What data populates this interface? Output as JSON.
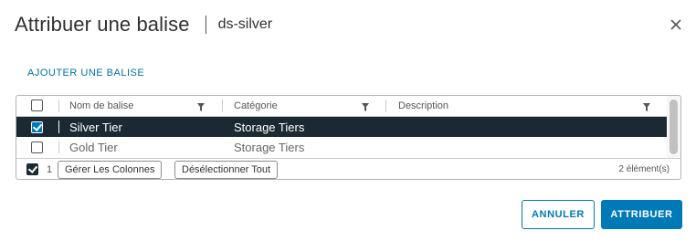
{
  "dialog": {
    "title": "Attribuer une balise",
    "subtitle": "ds-silver",
    "add_tag_label": "AJOUTER UNE BALISE"
  },
  "grid": {
    "columns": [
      {
        "label": "Nom de balise"
      },
      {
        "label": "Catégorie"
      },
      {
        "label": "Description"
      }
    ],
    "rows": [
      {
        "name": "Silver Tier",
        "category": "Storage Tiers",
        "description": "",
        "selected": true
      },
      {
        "name": "Gold Tier",
        "category": "Storage Tiers",
        "description": "",
        "selected": false
      }
    ],
    "footer": {
      "selected_count": "1",
      "manage_columns_label": "Gérer Les Colonnes",
      "deselect_all_label": "Désélectionner Tout",
      "item_count": "2 élément(s)"
    }
  },
  "actions": {
    "cancel_label": "ANNULER",
    "assign_label": "ATTRIBUER"
  },
  "colors": {
    "accent": "#0079b8",
    "selected_row": "#1b2a32"
  },
  "icons": [
    "close-icon",
    "filter-icon",
    "checkbox"
  ]
}
